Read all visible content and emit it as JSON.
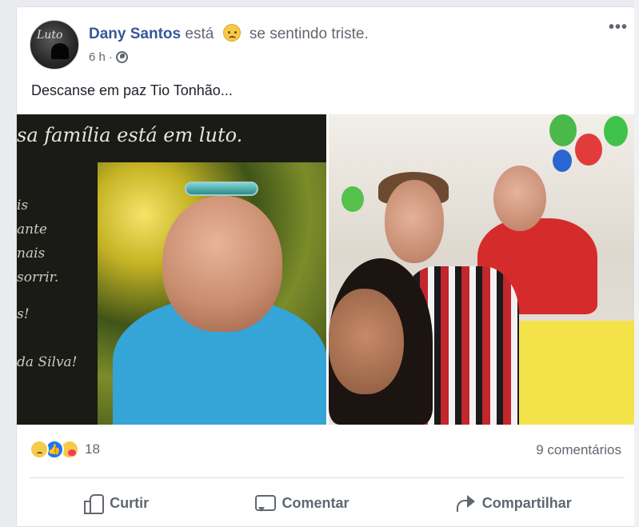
{
  "post": {
    "author": "Dany Santos",
    "status_prefix": "está",
    "feeling_icon": "sad-emoji",
    "feeling_text": "se sentindo triste.",
    "time": "6 h",
    "separator": "·",
    "privacy_icon": "globe-icon",
    "more_label": "•••",
    "text": "Descanse em paz Tio Tonhão...",
    "avatar_text": "Luto",
    "photo_left": {
      "headline": "sa família está em luto.",
      "side_lines": [
        "is",
        "ante",
        "nais",
        "sorrir.",
        "s!",
        "da Silva!"
      ]
    }
  },
  "reactions": {
    "icons": [
      "sad-reaction",
      "like-reaction",
      "care-reaction"
    ],
    "count": "18",
    "comments_label": "9 comentários"
  },
  "actions": {
    "like": "Curtir",
    "comment": "Comentar",
    "share": "Compartilhar"
  },
  "colors": {
    "link": "#365899",
    "gray_text": "#606770",
    "like_blue": "#1877f2"
  }
}
